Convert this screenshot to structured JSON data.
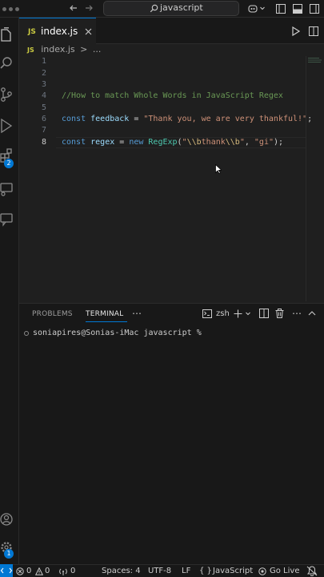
{
  "titlebar": {
    "search_text": "javascript"
  },
  "activity": {
    "extensions_badge": "2",
    "accounts_badge": "1"
  },
  "tab": {
    "icon_text": "JS",
    "label": "index.js"
  },
  "breadcrumb": {
    "file": "index.js",
    "separator": ">",
    "more": "..."
  },
  "editor": {
    "line_numbers": [
      "1",
      "2",
      "3",
      "4",
      "5",
      "6",
      "7",
      "8"
    ],
    "comment": "//How to match Whole Words in JavaScript Regex",
    "line6": {
      "kw": "const",
      "name": "feedback",
      "eq": " = ",
      "value": "\"Thank you, we are very thankful!\"",
      "end": ";"
    },
    "line8": {
      "kw": "const",
      "name": "regex",
      "eq": " = ",
      "new": "new",
      "cls": "RegExp",
      "open": "(",
      "q1": "\"",
      "esc1": "\\\\b",
      "word": "thank",
      "esc2": "\\\\b",
      "q2": "\"",
      "comma": ", ",
      "flags": "\"gi\"",
      "close": ");"
    }
  },
  "panel": {
    "tabs": [
      "PROBLEMS",
      "TERMINAL"
    ],
    "more": "⋯",
    "shell": "zsh",
    "prompt": "soniapires@Sonias-iMac javascript %"
  },
  "statusbar": {
    "errors": "0",
    "warnings": "0",
    "ports": "0",
    "spaces": "Spaces: 4",
    "encoding": "UTF-8",
    "eol": "LF",
    "language_icon": "{ }",
    "language": "JavaScript",
    "golive": "Go Live"
  },
  "colors": {
    "accent": "#0078d4",
    "background": "#1f1f1f",
    "keyword": "#569cd6",
    "string": "#ce9178",
    "comment": "#6a9955",
    "class": "#4ec9b0"
  }
}
